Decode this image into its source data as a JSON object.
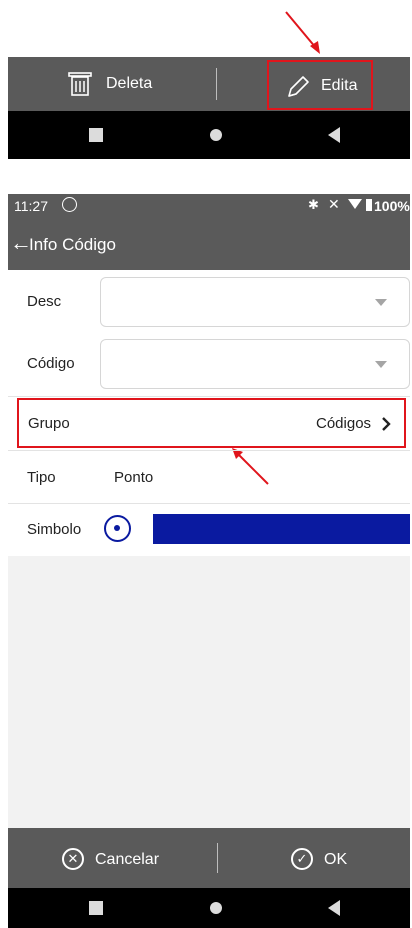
{
  "top_toolbar": {
    "delete_label": "Deleta",
    "edit_label": "Edita"
  },
  "status_bar": {
    "time": "11:27",
    "battery": "100%"
  },
  "app_bar": {
    "title": "Info Código"
  },
  "form": {
    "desc_label": "Desc",
    "codigo_label": "Código",
    "grupo_label": "Grupo",
    "grupo_value": "Códigos",
    "tipo_label": "Tipo",
    "tipo_value": "Ponto",
    "simbolo_label": "Simbolo",
    "simbolo_color": "#0a1aa0"
  },
  "bottom_bar": {
    "cancel_label": "Cancelar",
    "ok_label": "OK"
  },
  "colors": {
    "bar_bg": "#5a5a5a",
    "highlight": "#e0151c",
    "symbol_blue": "#0a1aa0"
  },
  "icons": [
    "trash-icon",
    "pencil-icon",
    "back-arrow-icon",
    "close-circle-icon",
    "check-circle-icon",
    "chevron-right-icon"
  ]
}
